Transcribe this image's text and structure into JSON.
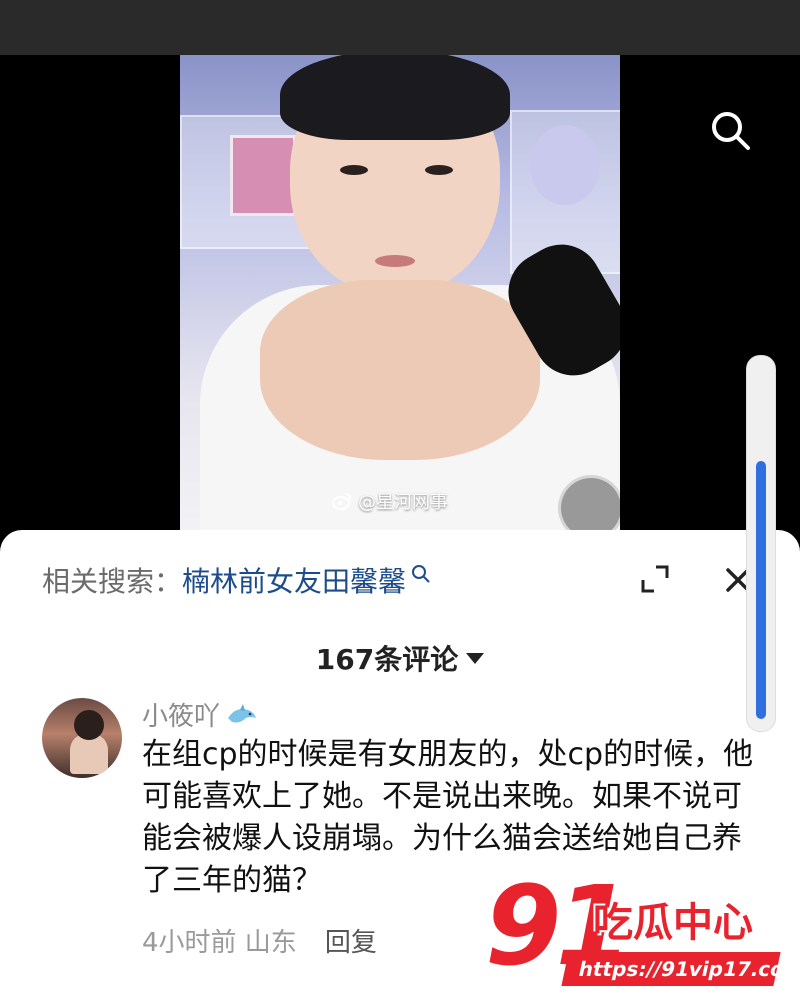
{
  "video": {
    "watermark_text": "@星河网事",
    "search_icon": "search-icon"
  },
  "comments_sheet": {
    "related_label": "相关搜索：",
    "related_query": "楠林前女友田馨馨",
    "comment_count": "167条评论",
    "comments": [
      {
        "username": "小筱吖",
        "badge_icon": "dolphin-icon",
        "text": "在组cp的时候是有女朋友的，处cp的时候，他可能喜欢上了她。不是说出来晚。如果不说可能会被爆人设崩塌。为什么猫会送给她自己养了三年的猫？",
        "time_location": "4小时前 山东",
        "reply_label": "回复"
      }
    ]
  },
  "logo": {
    "number": "91",
    "title": "吃瓜中心",
    "url": "https://91vip17.com",
    "brand_color": "#e8232e"
  },
  "colors": {
    "link": "#1d4c8c",
    "scrollbar_thumb": "#2f6fe0"
  }
}
